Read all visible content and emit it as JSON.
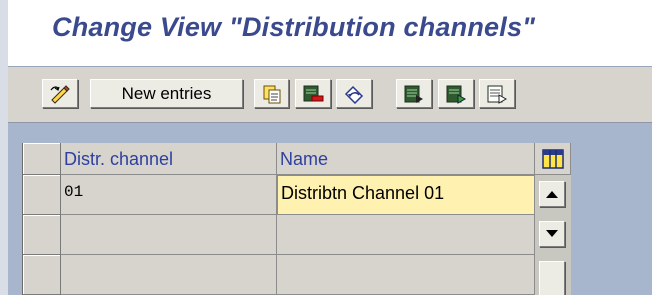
{
  "title": "Change View \"Distribution channels\"",
  "toolbar": {
    "new_entries_label": "New entries",
    "icons": [
      "edit-toggle-icon",
      "copy-as-icon",
      "delete-icon",
      "undo-change-icon",
      "select-all-icon",
      "select-block-icon",
      "deselect-all-icon"
    ]
  },
  "table": {
    "columns": [
      "Distr. channel",
      "Name"
    ],
    "rows": [
      {
        "distr_channel": "01",
        "name": "Distribtn Channel 01"
      },
      {
        "distr_channel": "",
        "name": ""
      },
      {
        "distr_channel": "",
        "name": ""
      }
    ]
  },
  "colors": {
    "title": "#3b4a8c",
    "header_text": "#2f40a0",
    "editable_cell": "#fff2b0",
    "background": "#a7b6cc"
  }
}
